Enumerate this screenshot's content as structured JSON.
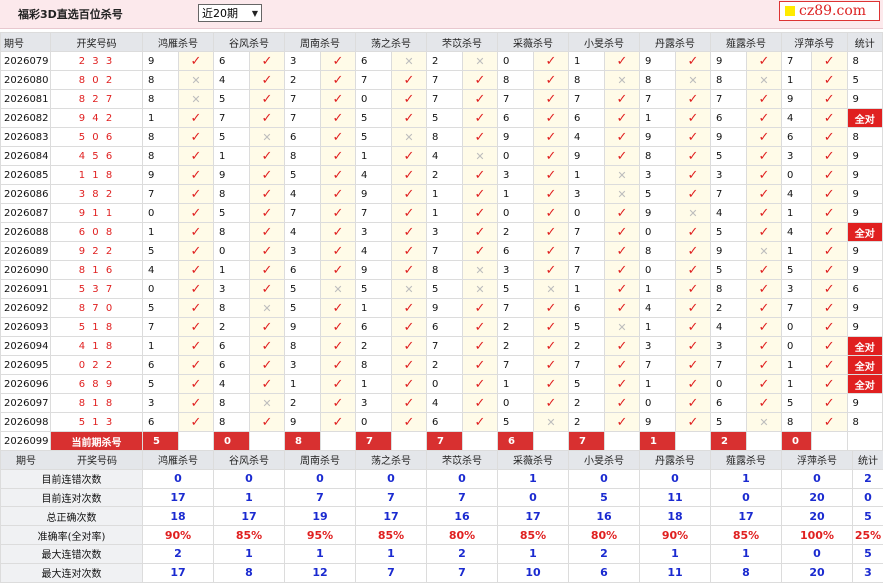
{
  "header": {
    "title": "福彩3D直选百位杀号",
    "period_select": "近20期",
    "brand": "cz89.com"
  },
  "columns": {
    "issue": "期号",
    "draw": "开奖号码",
    "experts": [
      "鸿雁杀号",
      "谷风杀号",
      "周南杀号",
      "荡之杀号",
      "芣苡杀号",
      "采薇杀号",
      "小旻杀号",
      "丹露杀号",
      "薤露杀号",
      "浮萍杀号"
    ],
    "count": "统计"
  },
  "rows": [
    {
      "issue": "2026079",
      "draw": "2 3 3",
      "kills": [
        9,
        6,
        3,
        6,
        2,
        0,
        1,
        9,
        9,
        7
      ],
      "marks": "OOOXXOOOOO",
      "count": "8"
    },
    {
      "issue": "2026080",
      "draw": "8 0 2",
      "kills": [
        8,
        4,
        2,
        7,
        7,
        8,
        8,
        8,
        8,
        1
      ],
      "marks": "XOOOOOXXXO",
      "count": "5"
    },
    {
      "issue": "2026081",
      "draw": "8 2 7",
      "kills": [
        8,
        5,
        7,
        0,
        7,
        7,
        7,
        7,
        7,
        9
      ],
      "marks": "XOOOOOOOOO",
      "count": "9"
    },
    {
      "issue": "2026082",
      "draw": "9 4 2",
      "kills": [
        1,
        7,
        7,
        5,
        5,
        6,
        6,
        1,
        6,
        4
      ],
      "marks": "OOOOOOOOOO",
      "count": "全对"
    },
    {
      "issue": "2026083",
      "draw": "5 0 6",
      "kills": [
        8,
        5,
        6,
        5,
        8,
        9,
        4,
        9,
        9,
        6
      ],
      "marks": "OXOXOOOOOO",
      "count": "8"
    },
    {
      "issue": "2026084",
      "draw": "4 5 6",
      "kills": [
        8,
        1,
        8,
        1,
        4,
        0,
        9,
        8,
        5,
        3
      ],
      "marks": "OOOOXOOOOO",
      "count": "9"
    },
    {
      "issue": "2026085",
      "draw": "1 1 8",
      "kills": [
        9,
        9,
        5,
        4,
        2,
        3,
        1,
        3,
        3,
        0
      ],
      "marks": "OOOOOOXOOO",
      "count": "9"
    },
    {
      "issue": "2026086",
      "draw": "3 8 2",
      "kills": [
        7,
        8,
        4,
        9,
        1,
        1,
        3,
        5,
        7,
        4
      ],
      "marks": "OOOOOOXOOO",
      "count": "9"
    },
    {
      "issue": "2026087",
      "draw": "9 1 1",
      "kills": [
        0,
        5,
        7,
        7,
        1,
        0,
        0,
        9,
        4,
        1
      ],
      "marks": "OOOOOOOXOO",
      "count": "9"
    },
    {
      "issue": "2026088",
      "draw": "6 0 8",
      "kills": [
        1,
        8,
        4,
        3,
        3,
        2,
        7,
        0,
        5,
        4
      ],
      "marks": "OOOOOOOOOO",
      "count": "全对"
    },
    {
      "issue": "2026089",
      "draw": "9 2 2",
      "kills": [
        5,
        0,
        3,
        4,
        7,
        6,
        7,
        8,
        9,
        1
      ],
      "marks": "OOOOOOOOXO",
      "count": "9"
    },
    {
      "issue": "2026090",
      "draw": "8 1 6",
      "kills": [
        4,
        1,
        6,
        9,
        8,
        3,
        7,
        0,
        5,
        5
      ],
      "marks": "OOOOXOOOOO",
      "count": "9"
    },
    {
      "issue": "2026091",
      "draw": "5 3 7",
      "kills": [
        0,
        3,
        5,
        5,
        5,
        5,
        1,
        1,
        8,
        3
      ],
      "marks": "OOXXXXOOOO",
      "count": "6"
    },
    {
      "issue": "2026092",
      "draw": "8 7 0",
      "kills": [
        5,
        8,
        5,
        1,
        9,
        7,
        6,
        4,
        2,
        7
      ],
      "marks": "OXOOOOOOOO",
      "count": "9"
    },
    {
      "issue": "2026093",
      "draw": "5 1 8",
      "kills": [
        7,
        2,
        9,
        6,
        6,
        2,
        5,
        1,
        4,
        0
      ],
      "marks": "OOOOOOXOOO",
      "count": "9"
    },
    {
      "issue": "2026094",
      "draw": "4 1 8",
      "kills": [
        1,
        6,
        8,
        2,
        7,
        2,
        2,
        3,
        3,
        0
      ],
      "marks": "OOOOOOOOOO",
      "count": "全对"
    },
    {
      "issue": "2026095",
      "draw": "0 2 2",
      "kills": [
        6,
        6,
        3,
        8,
        2,
        7,
        7,
        7,
        7,
        1
      ],
      "marks": "OOOOOOOOOO",
      "count": "全对"
    },
    {
      "issue": "2026096",
      "draw": "6 8 9",
      "kills": [
        5,
        4,
        1,
        1,
        0,
        1,
        5,
        1,
        0,
        1
      ],
      "marks": "OOOOOOOOOO",
      "count": "全对"
    },
    {
      "issue": "2026097",
      "draw": "8 1 8",
      "kills": [
        3,
        8,
        2,
        3,
        4,
        0,
        2,
        0,
        6,
        5
      ],
      "marks": "OXOOOOOOOO",
      "count": "9"
    },
    {
      "issue": "2026098",
      "draw": "5 1 3",
      "kills": [
        6,
        8,
        9,
        0,
        6,
        5,
        2,
        9,
        5,
        8
      ],
      "marks": "OOOOOXOOXO",
      "count": "8"
    }
  ],
  "current": {
    "issue": "2026099",
    "label": "当前期杀号",
    "kills": [
      "5",
      "0",
      "8",
      "7",
      "7",
      "6",
      "7",
      "1",
      "2",
      "0"
    ]
  },
  "stats_header": {
    "issue": "期号",
    "draw": "开奖号码",
    "count": "统计"
  },
  "stats": [
    {
      "label": "目前连错次数",
      "values": [
        "0",
        "0",
        "0",
        "0",
        "0",
        "1",
        "0",
        "0",
        "1",
        "0"
      ],
      "total": "2",
      "pct": false
    },
    {
      "label": "目前连对次数",
      "values": [
        "17",
        "1",
        "7",
        "7",
        "7",
        "0",
        "5",
        "11",
        "0",
        "20"
      ],
      "total": "0",
      "pct": false
    },
    {
      "label": "总正确次数",
      "values": [
        "18",
        "17",
        "19",
        "17",
        "16",
        "17",
        "16",
        "18",
        "17",
        "20"
      ],
      "total": "5",
      "pct": false
    },
    {
      "label": "准确率(全对率)",
      "values": [
        "90%",
        "85%",
        "95%",
        "85%",
        "80%",
        "85%",
        "80%",
        "90%",
        "85%",
        "100%"
      ],
      "total": "25%",
      "pct": true
    },
    {
      "label": "最大连错次数",
      "values": [
        "2",
        "1",
        "1",
        "1",
        "2",
        "1",
        "2",
        "1",
        "1",
        "0"
      ],
      "total": "5",
      "pct": false
    },
    {
      "label": "最大连对次数",
      "values": [
        "17",
        "8",
        "12",
        "7",
        "7",
        "10",
        "6",
        "11",
        "8",
        "20"
      ],
      "total": "3",
      "pct": false
    }
  ],
  "colors": {
    "accent": "#e02020",
    "stat_blue": "#1a2ad0",
    "header_bg": "#e4e6ea",
    "mark_bg": "#fffbe8"
  }
}
